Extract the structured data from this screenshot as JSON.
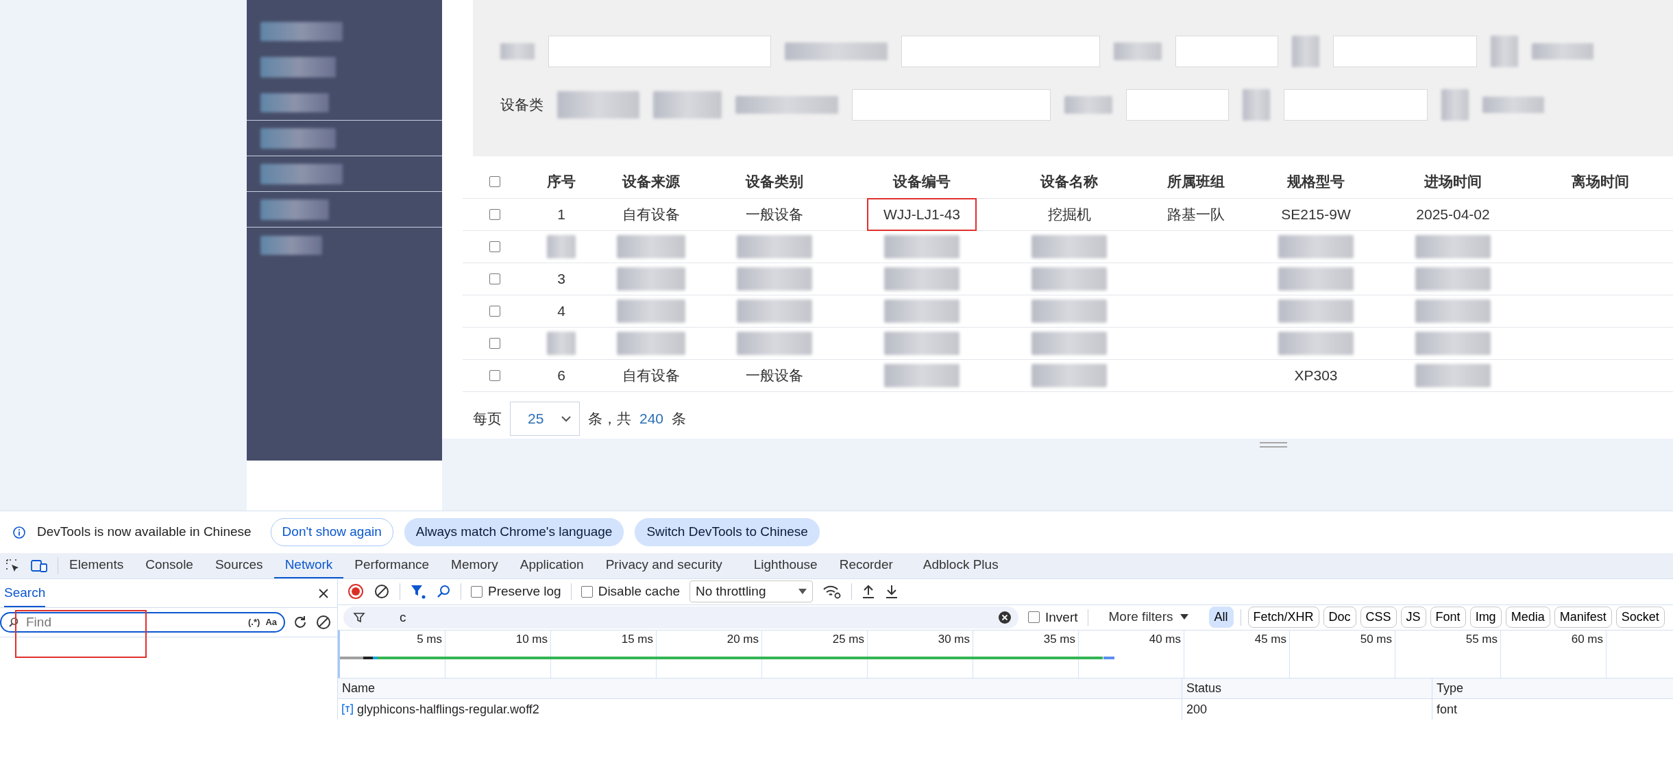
{
  "filters": {
    "labels": [
      {
        "text": "设备类"
      }
    ]
  },
  "table": {
    "columns": [
      {
        "kind": "checkbox",
        "checked": false
      },
      {
        "kind": "text",
        "label": "序号"
      },
      {
        "kind": "text",
        "label": "设备来源"
      },
      {
        "kind": "text",
        "label": "设备类别"
      },
      {
        "kind": "text",
        "label": "设备编号"
      },
      {
        "kind": "text",
        "label": "设备名称"
      },
      {
        "kind": "text",
        "label": "所属班组"
      },
      {
        "kind": "text",
        "label": "规格型号"
      },
      {
        "kind": "text",
        "label": "进场时间"
      },
      {
        "kind": "text",
        "label": "离场时间"
      }
    ],
    "rows": [
      {
        "cells": [
          {
            "kind": "checkbox",
            "checked": false
          },
          {
            "kind": "text",
            "text": "1"
          },
          {
            "kind": "text",
            "text": "自有设备"
          },
          {
            "kind": "text",
            "text": "一般设备"
          },
          {
            "kind": "text",
            "text": "WJJ-LJ1-43",
            "highlighted": true
          },
          {
            "kind": "text",
            "text": "挖掘机"
          },
          {
            "kind": "text",
            "text": "路基一队"
          },
          {
            "kind": "text",
            "text": "SE215-9W"
          },
          {
            "kind": "text",
            "text": "2025-04-02"
          },
          {
            "kind": "empty"
          }
        ]
      },
      {
        "cells": [
          {
            "kind": "checkbox",
            "checked": false
          },
          {
            "kind": "blurred"
          },
          {
            "kind": "blurred"
          },
          {
            "kind": "blurred"
          },
          {
            "kind": "blurred"
          },
          {
            "kind": "blurred"
          },
          {
            "kind": "empty"
          },
          {
            "kind": "blurred"
          },
          {
            "kind": "blurred"
          },
          {
            "kind": "empty"
          }
        ]
      },
      {
        "cells": [
          {
            "kind": "checkbox",
            "checked": false
          },
          {
            "kind": "text",
            "text": "3"
          },
          {
            "kind": "blurred"
          },
          {
            "kind": "blurred"
          },
          {
            "kind": "blurred"
          },
          {
            "kind": "blurred"
          },
          {
            "kind": "empty"
          },
          {
            "kind": "blurred"
          },
          {
            "kind": "blurred"
          },
          {
            "kind": "empty"
          }
        ]
      },
      {
        "cells": [
          {
            "kind": "checkbox",
            "checked": false
          },
          {
            "kind": "text",
            "text": "4"
          },
          {
            "kind": "blurred"
          },
          {
            "kind": "blurred"
          },
          {
            "kind": "blurred"
          },
          {
            "kind": "blurred"
          },
          {
            "kind": "empty"
          },
          {
            "kind": "blurred"
          },
          {
            "kind": "blurred"
          },
          {
            "kind": "empty"
          }
        ]
      },
      {
        "cells": [
          {
            "kind": "checkbox",
            "checked": false
          },
          {
            "kind": "blurred"
          },
          {
            "kind": "blurred"
          },
          {
            "kind": "blurred"
          },
          {
            "kind": "blurred"
          },
          {
            "kind": "blurred"
          },
          {
            "kind": "empty"
          },
          {
            "kind": "blurred"
          },
          {
            "kind": "blurred"
          },
          {
            "kind": "empty"
          }
        ]
      },
      {
        "cells": [
          {
            "kind": "checkbox",
            "checked": false
          },
          {
            "kind": "text",
            "text": "6"
          },
          {
            "kind": "text",
            "text": "自有设备"
          },
          {
            "kind": "text",
            "text": "一般设备"
          },
          {
            "kind": "blurred"
          },
          {
            "kind": "blurred"
          },
          {
            "kind": "empty"
          },
          {
            "kind": "text",
            "text": "XP303"
          },
          {
            "kind": "blurred"
          },
          {
            "kind": "empty"
          }
        ]
      }
    ]
  },
  "pagination": {
    "per_page_label": "每页",
    "page_size": "25",
    "total_prefix": "条，共",
    "total": "240",
    "total_suffix": "条"
  },
  "devtools": {
    "infobar": {
      "message": "DevTools is now available in Chinese",
      "buttons": [
        {
          "label": "Don't show again",
          "kind": "outline"
        },
        {
          "label": "Always match Chrome's language",
          "kind": "filled"
        },
        {
          "label": "Switch DevTools to Chinese",
          "kind": "filled"
        }
      ]
    },
    "tabs": [
      {
        "label": "Elements",
        "selected": false
      },
      {
        "label": "Console",
        "selected": false
      },
      {
        "label": "Sources",
        "selected": false
      },
      {
        "label": "Network",
        "selected": true
      },
      {
        "label": "Performance",
        "selected": false
      },
      {
        "label": "Memory",
        "selected": false
      },
      {
        "label": "Application",
        "selected": false
      },
      {
        "label": "Privacy and security",
        "selected": false
      },
      {
        "label": "Lighthouse",
        "selected": false
      },
      {
        "label": "Recorder",
        "selected": false
      },
      {
        "label": "Adblock Plus",
        "selected": false
      }
    ],
    "search_panel": {
      "title": "Search",
      "placeholder": "Find",
      "regex": "(.*)",
      "match_case": "Aa",
      "highlighted": true
    },
    "toolbar": {
      "preserve_log": {
        "label": "Preserve log",
        "checked": false
      },
      "disable_cache": {
        "label": "Disable cache",
        "checked": false
      },
      "throttling": "No throttling"
    },
    "filter": {
      "value": "c",
      "invert": {
        "label": "Invert",
        "checked": false
      },
      "more_filters": "More filters",
      "types": [
        {
          "label": "All",
          "selected": true
        },
        {
          "label": "Fetch/XHR",
          "selected": false
        },
        {
          "label": "Doc",
          "selected": false
        },
        {
          "label": "CSS",
          "selected": false
        },
        {
          "label": "JS",
          "selected": false
        },
        {
          "label": "Font",
          "selected": false
        },
        {
          "label": "Img",
          "selected": false
        },
        {
          "label": "Media",
          "selected": false
        },
        {
          "label": "Manifest",
          "selected": false
        },
        {
          "label": "Socket",
          "selected": false
        }
      ]
    },
    "timeline": {
      "ticks": [
        "5 ms",
        "10 ms",
        "15 ms",
        "20 ms",
        "25 ms",
        "30 ms",
        "35 ms",
        "40 ms",
        "45 ms",
        "50 ms",
        "55 ms",
        "60 ms"
      ]
    },
    "requests": {
      "columns": [
        "Name",
        "Status",
        "Type"
      ],
      "rows": [
        {
          "name": "glyphicons-halflings-regular.woff2",
          "status": "200",
          "type": "font"
        }
      ]
    }
  }
}
